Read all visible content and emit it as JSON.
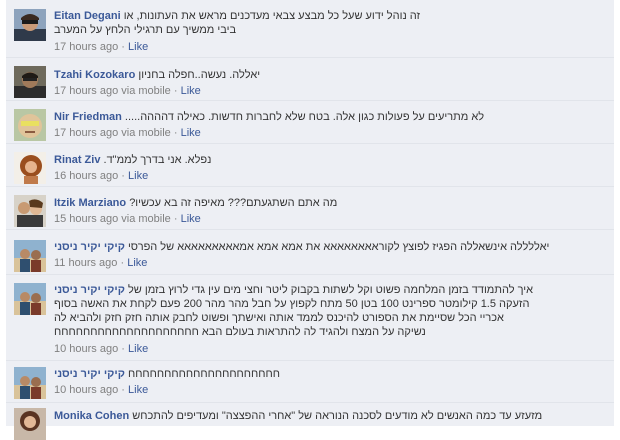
{
  "comments": [
    {
      "author": "Eitan Degani",
      "lines": [
        "זה נוהל ידוע שעל כל מבצע צבאי מעדכנים מראש את העתונות, או",
        "ביבי ממשיך עם תרגילי הלחץ על המערב"
      ],
      "time": "17 hours ago",
      "like": "Like",
      "avatar_icon": "man-sunglasses-avatar"
    },
    {
      "author": "Tzahi Kozokaro",
      "lines": [
        "יאללה. נעשה..חפלה בחניון"
      ],
      "time": "17 hours ago via mobile",
      "like": "Like",
      "avatar_icon": "man-dark-avatar"
    },
    {
      "author": "Nir Friedman",
      "lines": [
        "לא מתריעים על פעולות כגון אלה. בטח שלא לחברות חדשות. כאילה דהההה....."
      ],
      "time": "17 hours ago via mobile",
      "like": "Like",
      "avatar_icon": "face-closeup-avatar"
    },
    {
      "author": "Rinat Ziv",
      "lines": [
        "נפלא. אני בדרך לממ\"ד."
      ],
      "time": "16 hours ago",
      "like": "Like",
      "avatar_icon": "woman-curly-hair-avatar"
    },
    {
      "author": "Itzik Marziano",
      "lines": [
        "מה אתם השתגעתם??? מאיפה זה בא עכשיו?"
      ],
      "time": "15 hours ago via mobile",
      "like": "Like",
      "avatar_icon": "couple-photo-avatar"
    },
    {
      "author": "קיקי יקיר ניסני",
      "lines": [
        "יאללללה אינשאללה הפגיז לפוצץ לקוראאאאאאאא את אמא אמא אמאאאאאאאאא של הפרסי"
      ],
      "time": "11 hours ago",
      "like": "Like",
      "avatar_icon": "beach-photo-avatar"
    },
    {
      "author": "קיקי יקיר ניסני",
      "lines": [
        "איך להתמודד בזמן המלחמה פשוט וקל לשתות בקבוק ליטר וחצי מים עין גדי לרוץ בזמן של",
        "הזעקה 1.5 קילומטר ספרינט 100 בטן 50 מתח לקפוץ על חבל מהר מהר 200 פעם לקחת את האשה בסוף",
        "אכריי הכל שסיימת את הספורט להיכנס לממד אותה ואישתך ופשוט לחבק אותה חזק חזק ולהביא לה",
        "נשיקה על המצח ולהגיד לה להתראות בעולם הבא חחחחחחחחחחחחחחחחחחחח"
      ],
      "time": "10 hours ago",
      "like": "Like",
      "avatar_icon": "beach-photo-avatar"
    },
    {
      "author": "קיקי יקיר ניסני",
      "lines": [
        "חחחחחחחחחחחחחחחחחחחחח"
      ],
      "time": "10 hours ago",
      "like": "Like",
      "avatar_icon": "beach-photo-avatar"
    },
    {
      "author": "Monika Cohen",
      "lines": [
        "מזעזע עד כמה האנשים לא מודעים לסכנה הנוראה של \"אחרי ההפצצה\" ומעדיפים להתכחש"
      ],
      "time": "",
      "like": "",
      "avatar_icon": "woman-avatar"
    }
  ]
}
